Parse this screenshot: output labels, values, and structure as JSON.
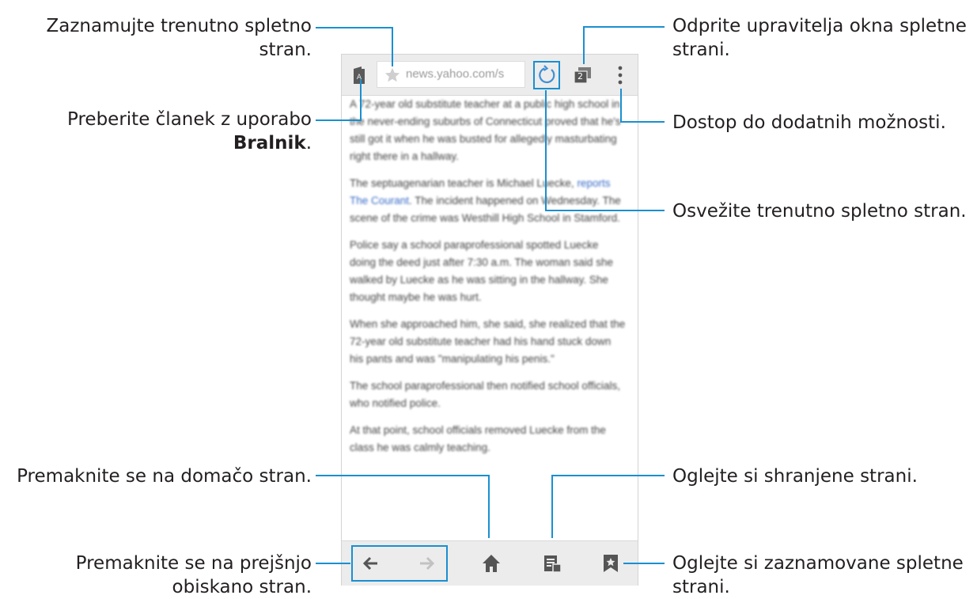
{
  "colors": {
    "callout_line": "#1a8fd1",
    "toolbar": "#ececec"
  },
  "browser": {
    "url": "news.yahoo.com/s",
    "tab_count": "2"
  },
  "article": {
    "p1": "A 72-year old substitute teacher at a public high school in the never-ending suburbs of Connecticut proved that he's still got it when he was busted for allegedly masturbating right there in a hallway.",
    "p2_a": "The septuagenarian teacher is Michael Luecke, ",
    "p2_link": "reports The Courant",
    "p2_b": ". The incident happened on Wednesday. The scene of the crime was Westhill High School in Stamford.",
    "p3": "Police say a school paraprofessional spotted Luecke doing the deed just after 7:30 a.m. The woman said she walked by Luecke as he was sitting in the hallway. She thought maybe he was hurt.",
    "p4": "When she approached him, she said, she realized that the 72-year old substitute teacher had his hand stuck down his pants and was \"manipulating his penis.\"",
    "p5": "The school paraprofessional then notified school officials, who notified police.",
    "p6": "At that point, school officials removed Luecke from the class he was calmly teaching."
  },
  "callouts": {
    "bookmark_current": "Zaznamujte trenutno spletno stran.",
    "reader_a": "Preberite članek z uporabo ",
    "reader_b": "Bralnik",
    "reader_c": ".",
    "home": "Premaknite se na domačo stran.",
    "back_l1": "Premaknite se na prejšnjo",
    "back_l2": "obiskano stran.",
    "window_manager_l1": "Odprite upravitelja okna spletne",
    "window_manager_l2": "strani.",
    "more_options": "Dostop do dodatnih možnosti.",
    "refresh": "Osvežite trenutno spletno stran.",
    "saved_pages": "Oglejte si shranjene strani.",
    "bookmarks_l1": "Oglejte si zaznamovane spletne",
    "bookmarks_l2": "strani."
  }
}
